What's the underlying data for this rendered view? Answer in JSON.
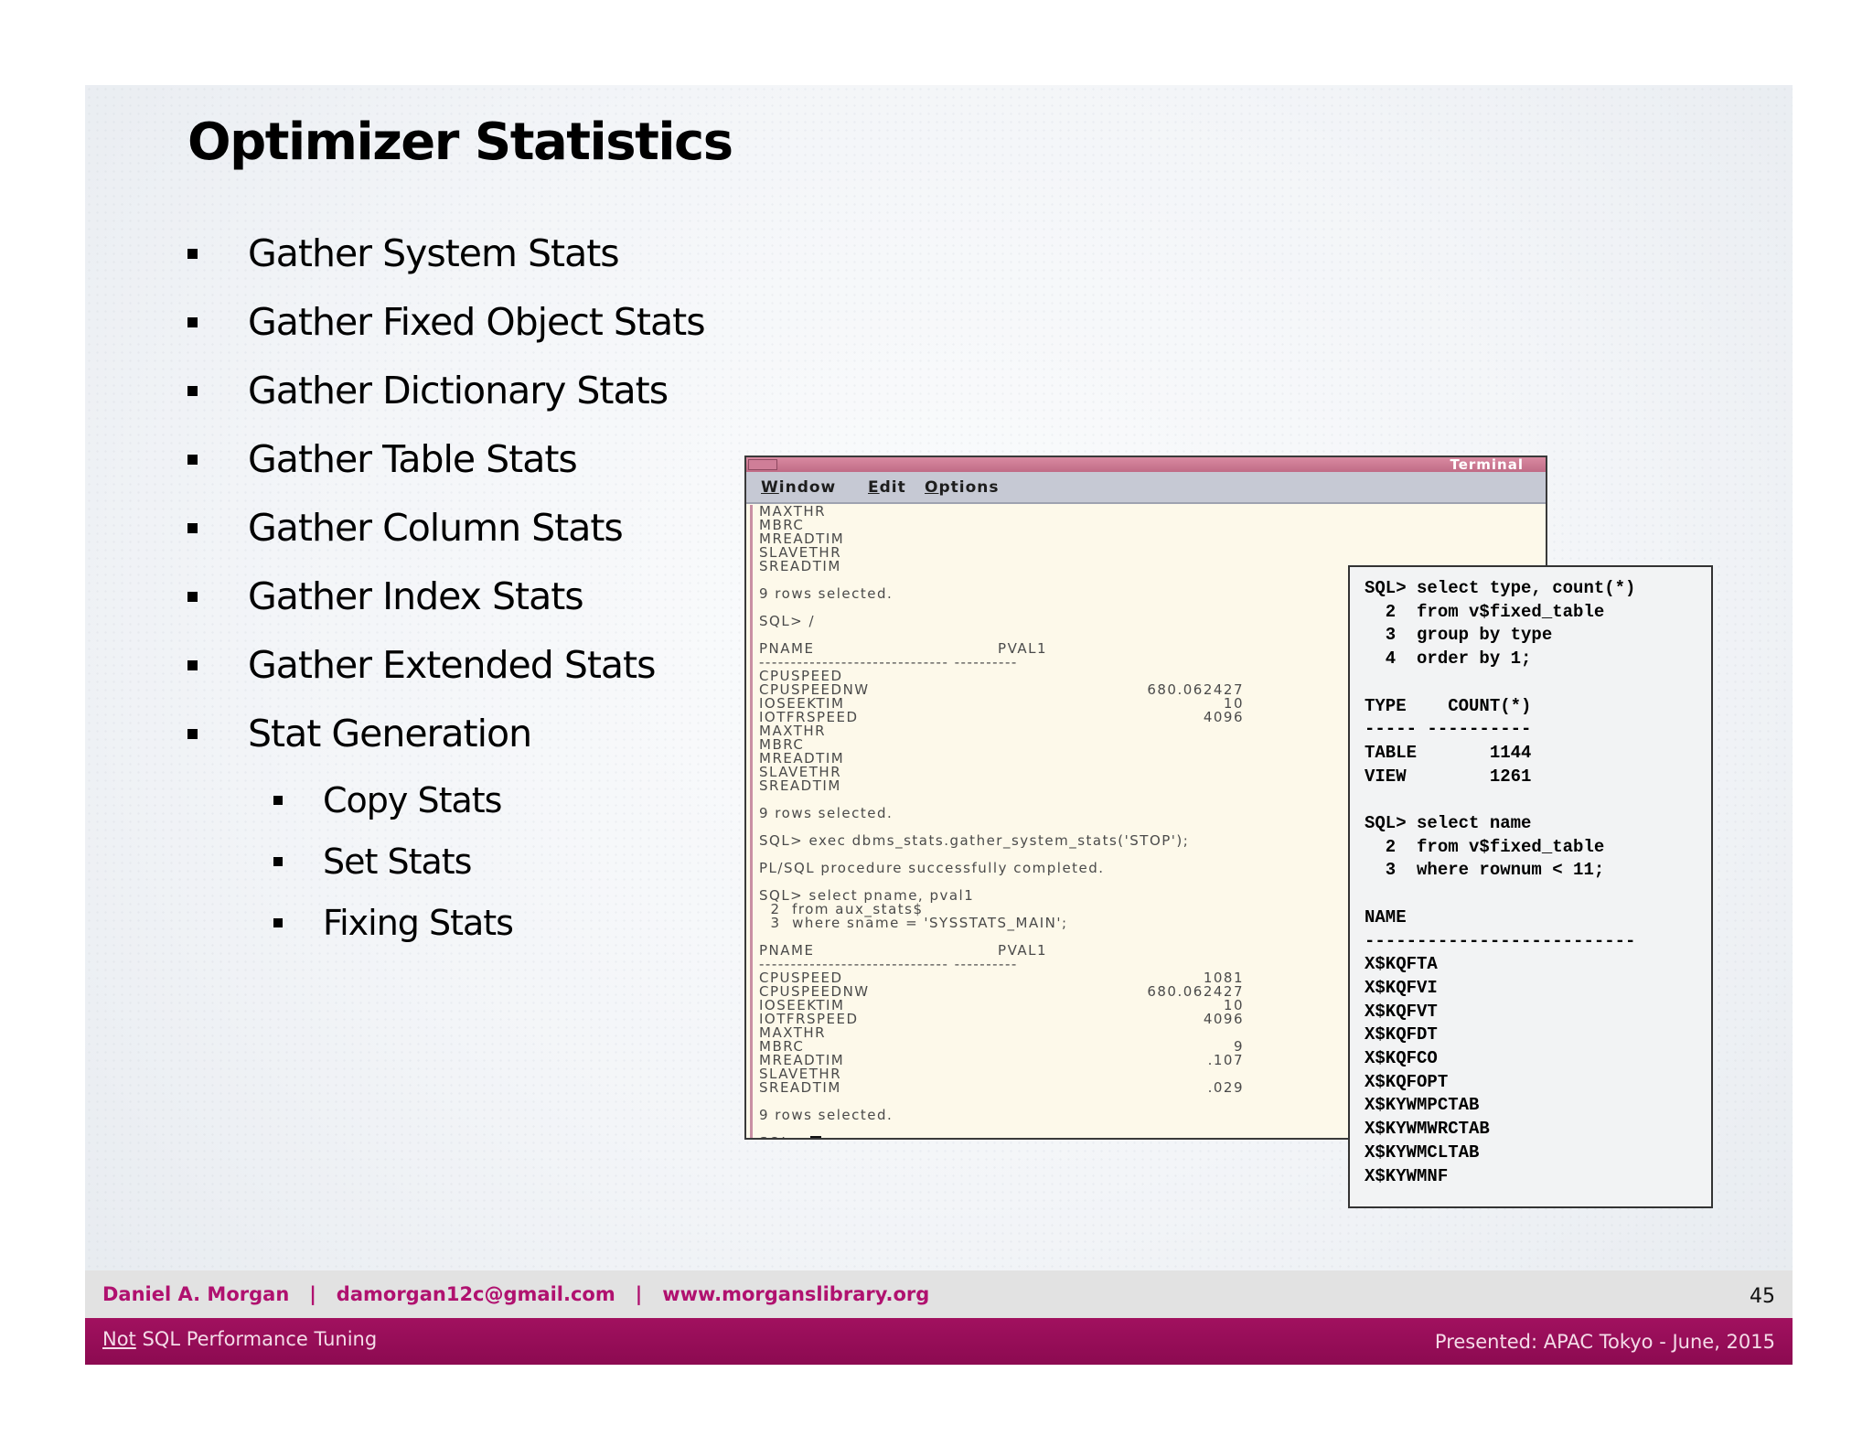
{
  "slide": {
    "title": "Optimizer Statistics",
    "bullets": [
      "Gather System Stats",
      "Gather Fixed Object Stats",
      "Gather Dictionary Stats",
      "Gather Table Stats",
      "Gather Column Stats",
      "Gather Index Stats",
      "Gather Extended Stats",
      "Stat Generation"
    ],
    "sub_bullets": [
      "Copy Stats",
      "Set Stats",
      "Fixing Stats"
    ]
  },
  "terminal": {
    "title": "Terminal",
    "menu": [
      "Window",
      "Edit",
      "Options"
    ],
    "lines": [
      {
        "t": "MAXTHR"
      },
      {
        "t": "MBRC"
      },
      {
        "t": "MREADTIM"
      },
      {
        "t": "SLAVETHR"
      },
      {
        "t": "SREADTIM"
      },
      {
        "t": "9 rows selected.",
        "gap": true
      },
      {
        "t": "SQL> /",
        "gap": true
      },
      {
        "t": "PNAME                                PVAL1",
        "gap": true
      },
      {
        "t": "------------------------------ ----------"
      },
      {
        "t": "CPUSPEED"
      },
      {
        "t": "CPUSPEEDNW",
        "v": "680.062427"
      },
      {
        "t": "IOSEEKTIM",
        "v": "10"
      },
      {
        "t": "IOTFRSPEED",
        "v": "4096"
      },
      {
        "t": "MAXTHR"
      },
      {
        "t": "MBRC"
      },
      {
        "t": "MREADTIM"
      },
      {
        "t": "SLAVETHR"
      },
      {
        "t": "SREADTIM"
      },
      {
        "t": "9 rows selected.",
        "gap": true
      },
      {
        "t": "SQL> exec dbms_stats.gather_system_stats('STOP');",
        "gap": true
      },
      {
        "t": "PL/SQL procedure successfully completed.",
        "gap": true
      },
      {
        "t": "SQL> select pname, pval1",
        "gap": true
      },
      {
        "t": "  2  from aux_stats$"
      },
      {
        "t": "  3  where sname = 'SYSSTATS_MAIN';"
      },
      {
        "t": "PNAME                                PVAL1",
        "gap": true
      },
      {
        "t": "------------------------------ ----------"
      },
      {
        "t": "CPUSPEED",
        "v": "1081"
      },
      {
        "t": "CPUSPEEDNW",
        "v": "680.062427"
      },
      {
        "t": "IOSEEKTIM",
        "v": "10"
      },
      {
        "t": "IOTFRSPEED",
        "v": "4096"
      },
      {
        "t": "MAXTHR"
      },
      {
        "t": "MBRC",
        "v": "9"
      },
      {
        "t": "MREADTIM",
        "v": ".107"
      },
      {
        "t": "SLAVETHR"
      },
      {
        "t": "SREADTIM",
        "v": ".029"
      },
      {
        "t": "9 rows selected.",
        "gap": true
      },
      {
        "t": "SQL>",
        "gap": true,
        "cursor": true
      }
    ]
  },
  "sql_panel": {
    "lines": [
      "SQL> select type, count(*)",
      "  2  from v$fixed_table",
      "  3  group by type",
      "  4  order by 1;",
      "",
      "TYPE    COUNT(*)",
      "----- ----------",
      "TABLE       1144",
      "VIEW        1261",
      "",
      "SQL> select name",
      "  2  from v$fixed_table",
      "  3  where rownum < 11;",
      "",
      "NAME",
      "--------------------------",
      "X$KQFTA",
      "X$KQFVI",
      "X$KQFVT",
      "X$KQFDT",
      "X$KQFCO",
      "X$KQFOPT",
      "X$KYWMPCTAB",
      "X$KYWMWRCTAB",
      "X$KYWMCLTAB",
      "X$KYWMNF"
    ]
  },
  "footer": {
    "info": "Daniel A. Morgan   |   damorgan12c@gmail.com   |   www.morganslibrary.org",
    "page_number": "45",
    "not_word": "Not",
    "course_rest": " SQL Performance Tuning",
    "presented": "Presented: APAC Tokyo  - June, 2015"
  },
  "colors": {
    "accent": "#a1115f",
    "footer_text": "#b0116f",
    "terminal_bg": "#fdf9ea"
  }
}
